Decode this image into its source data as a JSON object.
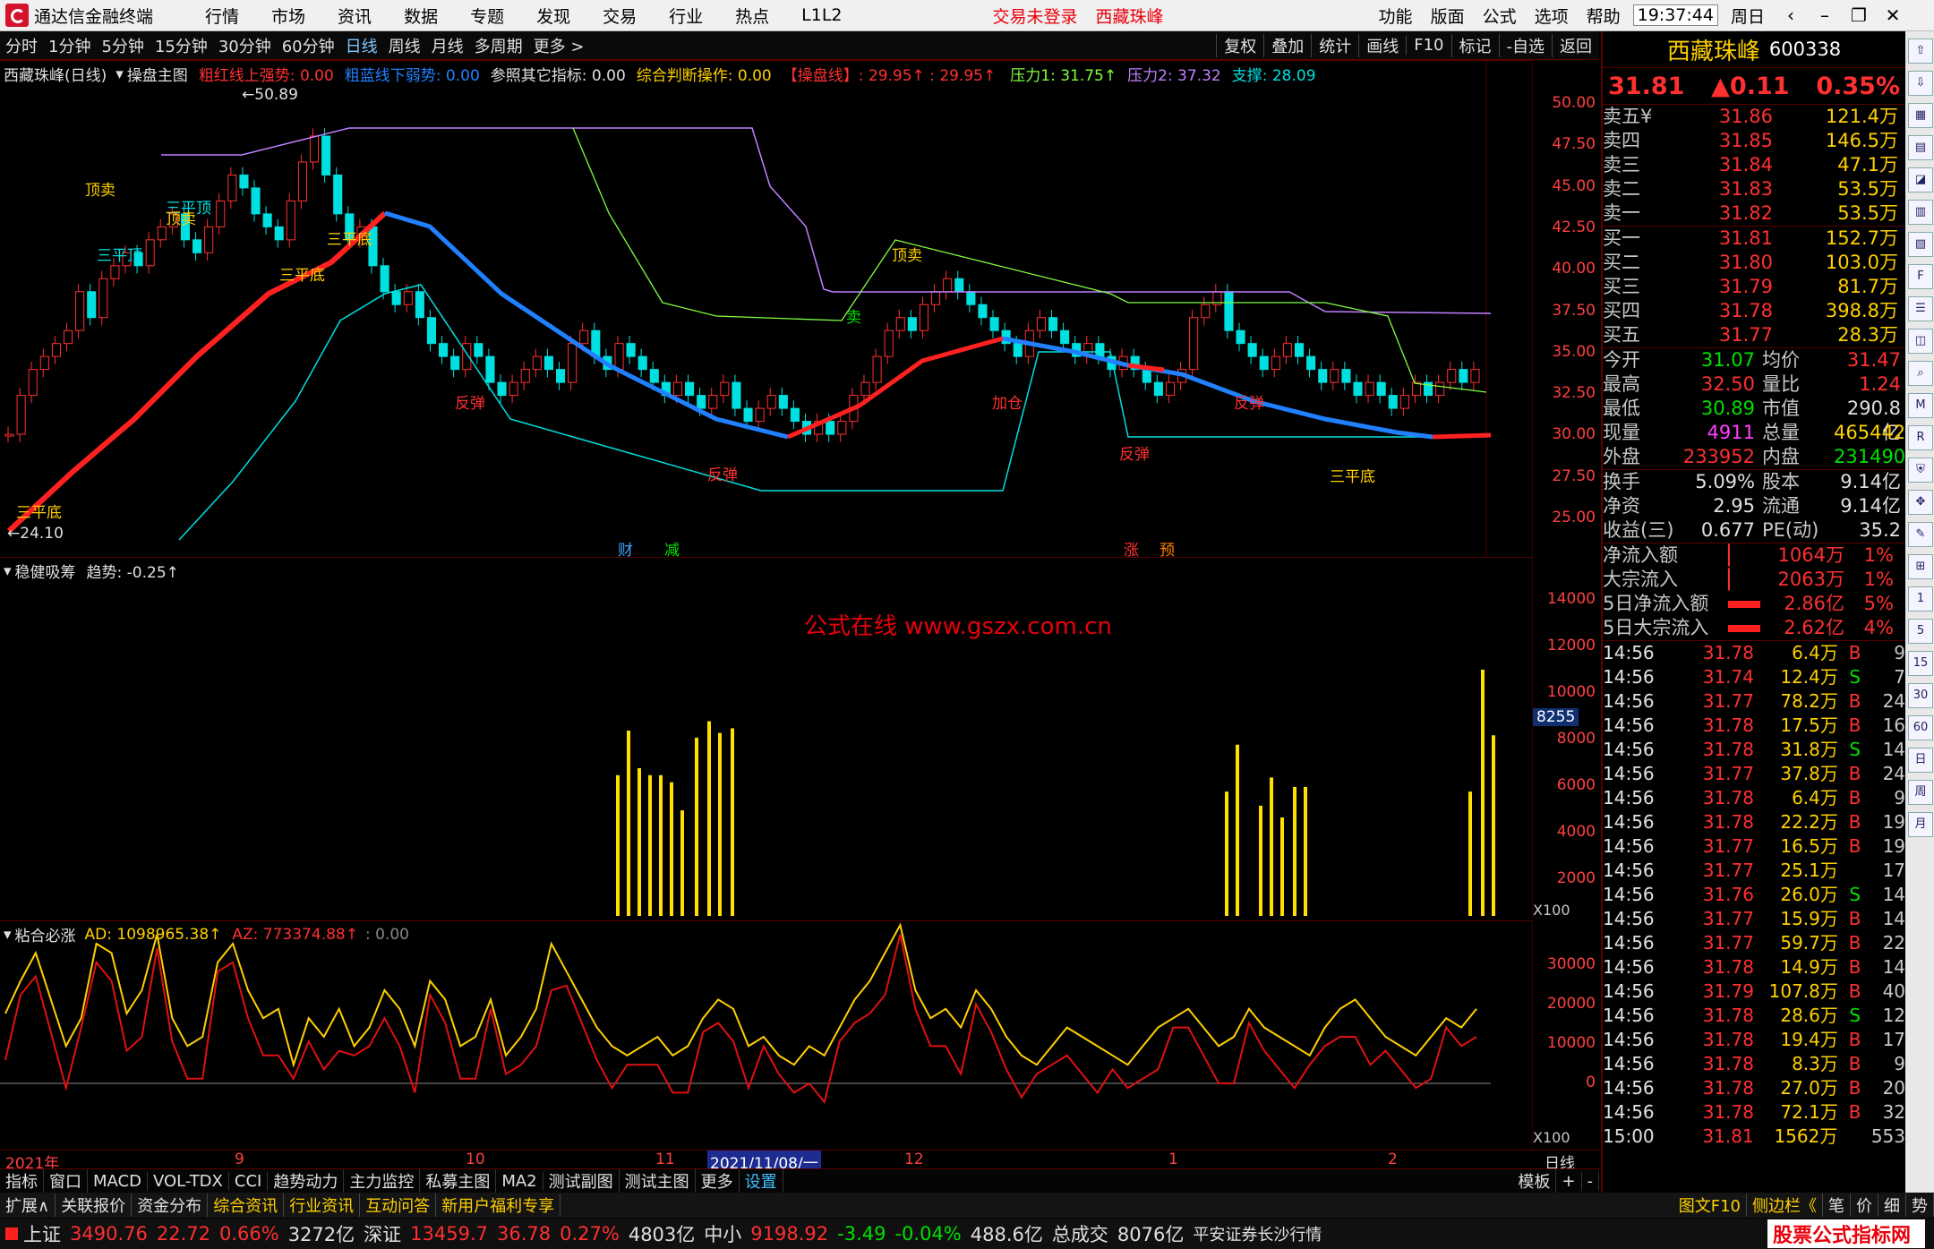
{
  "titlebar": {
    "app_name": "通达信金融终端",
    "menu": [
      "行情",
      "市场",
      "资讯",
      "数据",
      "专题",
      "发现",
      "交易",
      "行业",
      "热点",
      "L1L2"
    ],
    "login": "交易未登录",
    "stock": "西藏珠峰",
    "right_menu": [
      "功能",
      "版面",
      "公式",
      "选项",
      "帮助"
    ],
    "time": "19:37:44",
    "weekday": "周日"
  },
  "toolbar": {
    "periods": [
      "分时",
      "1分钟",
      "5分钟",
      "15分钟",
      "30分钟",
      "60分钟",
      "日线",
      "周线",
      "月线",
      "多周期",
      "更多 >"
    ],
    "selected": "日线",
    "right_buttons": [
      "复权",
      "叠加",
      "统计",
      "画线",
      "F10",
      "标记",
      "-自选",
      "返回"
    ]
  },
  "main_chart": {
    "title": "西藏珠峰(日线)",
    "indicator": "操盘主图",
    "legend": [
      {
        "text": "粗红线上强势: 0.00",
        "color": "#ff3030"
      },
      {
        "text": "粗蓝线下弱势: 0.00",
        "color": "#2080ff"
      },
      {
        "text": "参照其它指标: 0.00",
        "color": "#e0e0e0"
      },
      {
        "text": "综合判断操作: 0.00",
        "color": "#ffd000"
      },
      {
        "text": "【操盘线】: 29.95↑ : 29.95↑",
        "color": "#ff3030"
      },
      {
        "text": "压力1: 31.75↑",
        "color": "#80ff40"
      },
      {
        "text": "压力2: 37.32",
        "color": "#c080ff"
      },
      {
        "text": "支撑: 28.09",
        "color": "#00e0e0"
      }
    ],
    "yticks": [
      "50.00",
      "47.50",
      "45.00",
      "42.50",
      "40.00",
      "37.50",
      "35.00",
      "32.50",
      "30.00",
      "27.50",
      "25.00"
    ],
    "high_label": "50.89",
    "low_label": "24.10",
    "signals": [
      "顶卖",
      "三平顶",
      "顶卖",
      "三平顶",
      "三平底",
      "三平底",
      "三平底",
      "顶卖",
      "反弹",
      "反弹",
      "反弹",
      "加仓",
      "反弹",
      "三平底",
      "卖"
    ],
    "event_tags": [
      "财",
      "减",
      "涨",
      "预"
    ]
  },
  "sub1": {
    "title": "稳健吸筹",
    "legend": "趋势: -0.25↑",
    "watermark": "公式在线   www.gszx.com.cn",
    "yticks": [
      "14000",
      "12000",
      "10000",
      "8000",
      "6000",
      "4000",
      "2000"
    ],
    "current_value": "8255",
    "unit": "X100"
  },
  "sub2": {
    "title": "粘合必涨",
    "legend_ad": "AD: 1098965.38↑",
    "legend_az": "AZ: 773374.88↑",
    "legend_zero": ": 0.00",
    "yticks": [
      "30000",
      "20000",
      "10000",
      "0"
    ],
    "unit": "X100"
  },
  "xaxis": {
    "labels": [
      "2021年",
      "9",
      "10",
      "11",
      "2021/11/08/一",
      "12",
      "1",
      "2",
      "日线"
    ]
  },
  "quote": {
    "name": "西藏珠峰",
    "code": "600338",
    "price": "31.81",
    "change": "▲0.11",
    "pct": "0.35%",
    "asks": [
      {
        "label": "卖五",
        "mark": "¥",
        "price": "31.86",
        "vol": "121.4万"
      },
      {
        "label": "卖四",
        "mark": "",
        "price": "31.85",
        "vol": "146.5万"
      },
      {
        "label": "卖三",
        "mark": "",
        "price": "31.84",
        "vol": "47.1万"
      },
      {
        "label": "卖二",
        "mark": "",
        "price": "31.83",
        "vol": "53.5万"
      },
      {
        "label": "卖一",
        "mark": "",
        "price": "31.82",
        "vol": "53.5万"
      }
    ],
    "bids": [
      {
        "label": "买一",
        "price": "31.81",
        "vol": "152.7万"
      },
      {
        "label": "买二",
        "price": "31.80",
        "vol": "103.0万"
      },
      {
        "label": "买三",
        "price": "31.79",
        "vol": "81.7万"
      },
      {
        "label": "买四",
        "price": "31.78",
        "vol": "398.8万"
      },
      {
        "label": "买五",
        "price": "31.77",
        "vol": "28.3万"
      }
    ],
    "stats": [
      {
        "l1": "今开",
        "v1": "31.07",
        "c1": "grn",
        "l2": "均价",
        "v2": "31.47",
        "c2": "red"
      },
      {
        "l1": "最高",
        "v1": "32.50",
        "c1": "red",
        "l2": "量比",
        "v2": "1.24",
        "c2": "red"
      },
      {
        "l1": "最低",
        "v1": "30.89",
        "c1": "grn",
        "l2": "市值",
        "v2": "290.8亿",
        "c2": "wht"
      },
      {
        "l1": "现量",
        "v1": "4911",
        "c1": "mag",
        "l2": "总量",
        "v2": "465442",
        "c2": "yel"
      },
      {
        "l1": "外盘",
        "v1": "233952",
        "c1": "red",
        "l2": "内盘",
        "v2": "231490",
        "c2": "grn"
      }
    ],
    "stats2": [
      {
        "l1": "换手",
        "v1": "5.09%",
        "l2": "股本",
        "v2": "9.14亿"
      },
      {
        "l1": "净资",
        "v1": "2.95",
        "l2": "流通",
        "v2": "9.14亿"
      },
      {
        "l1": "收益(三)",
        "v1": "0.677",
        "l2": "PE(动)",
        "v2": "35.2"
      }
    ],
    "flows": [
      {
        "label": "净流入额",
        "val": "1064万",
        "pct": "1%"
      },
      {
        "label": "大宗流入",
        "val": "2063万",
        "pct": "1%"
      },
      {
        "label": "5日净流入额",
        "val": "2.86亿",
        "pct": "5%"
      },
      {
        "label": "5日大宗流入",
        "val": "2.62亿",
        "pct": "4%"
      }
    ],
    "ticks": [
      {
        "t": "14:56",
        "p": "31.78",
        "v": "6.4万",
        "bs": "B",
        "n": "9"
      },
      {
        "t": "14:56",
        "p": "31.74",
        "v": "12.4万",
        "bs": "S",
        "n": "7"
      },
      {
        "t": "14:56",
        "p": "31.77",
        "v": "78.2万",
        "bs": "B",
        "n": "24"
      },
      {
        "t": "14:56",
        "p": "31.78",
        "v": "17.5万",
        "bs": "B",
        "n": "16"
      },
      {
        "t": "14:56",
        "p": "31.78",
        "v": "31.8万",
        "bs": "S",
        "n": "14"
      },
      {
        "t": "14:56",
        "p": "31.77",
        "v": "37.8万",
        "bs": "B",
        "n": "24"
      },
      {
        "t": "14:56",
        "p": "31.78",
        "v": "6.4万",
        "bs": "B",
        "n": "9"
      },
      {
        "t": "14:56",
        "p": "31.78",
        "v": "22.2万",
        "bs": "B",
        "n": "19"
      },
      {
        "t": "14:56",
        "p": "31.77",
        "v": "16.5万",
        "bs": "B",
        "n": "19"
      },
      {
        "t": "14:56",
        "p": "31.77",
        "v": "25.1万",
        "bs": "",
        "n": "17"
      },
      {
        "t": "14:56",
        "p": "31.76",
        "v": "26.0万",
        "bs": "S",
        "n": "14"
      },
      {
        "t": "14:56",
        "p": "31.77",
        "v": "15.9万",
        "bs": "B",
        "n": "14"
      },
      {
        "t": "14:56",
        "p": "31.77",
        "v": "59.7万",
        "bs": "B",
        "n": "22"
      },
      {
        "t": "14:56",
        "p": "31.78",
        "v": "14.9万",
        "bs": "B",
        "n": "14"
      },
      {
        "t": "14:56",
        "p": "31.79",
        "v": "107.8万",
        "bs": "B",
        "n": "40"
      },
      {
        "t": "14:56",
        "p": "31.78",
        "v": "28.6万",
        "bs": "S",
        "n": "12"
      },
      {
        "t": "14:56",
        "p": "31.78",
        "v": "19.4万",
        "bs": "B",
        "n": "17"
      },
      {
        "t": "14:56",
        "p": "31.78",
        "v": "8.3万",
        "bs": "B",
        "n": "9"
      },
      {
        "t": "14:56",
        "p": "31.78",
        "v": "27.0万",
        "bs": "B",
        "n": "20"
      },
      {
        "t": "14:56",
        "p": "31.78",
        "v": "72.1万",
        "bs": "B",
        "n": "32"
      },
      {
        "t": "15:00",
        "p": "31.81",
        "v": "1562万",
        "bs": "",
        "n": "553"
      }
    ]
  },
  "tabs1": [
    "指标",
    "窗口",
    "MACD",
    "VOL-TDX",
    "CCI",
    "趋势动力",
    "主力监控",
    "私募主图",
    "MA2",
    "测试副图",
    "测试主图",
    "更多",
    "设置"
  ],
  "tabs1_right": [
    "模板",
    "+",
    "-"
  ],
  "tabs2": [
    "扩展∧",
    "关联报价",
    "资金分布",
    "综合资讯",
    "行业资讯",
    "互动问答",
    "新用户福利专享"
  ],
  "tabs2_right": [
    "图文F10",
    "侧边栏《",
    "笔",
    "价",
    "细",
    "势"
  ],
  "status": {
    "sh_label": "上证",
    "sh_val": "3490.76",
    "sh_chg": "22.72",
    "sh_pct": "0.66%",
    "sh_amt": "3272亿",
    "sz_label": "深证",
    "sz_val": "13459.7",
    "sz_chg": "36.78",
    "sz_pct": "0.27%",
    "sz_amt": "4803亿",
    "zx_label": "中小",
    "zx_val": "9198.92",
    "zx_chg": "-3.49",
    "zx_pct": "-0.04%",
    "zx_amt": "488.6亿",
    "total_label": "总成交",
    "total_val": "8076亿",
    "broker": "平安证券长沙行情",
    "site": "股票公式指标网",
    "site_url": "www.gszx.com.cn"
  }
}
